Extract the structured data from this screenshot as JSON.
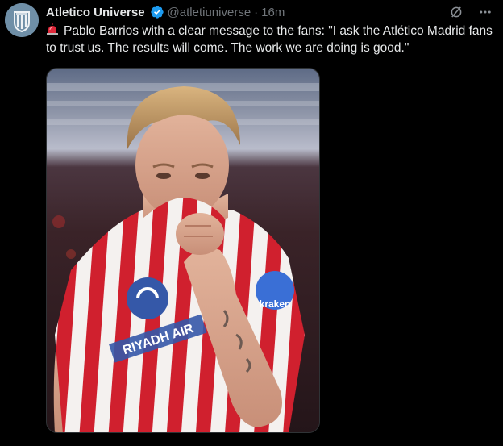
{
  "account": {
    "display_name": "Atletico Universe",
    "handle": "@atletiuniverse",
    "separator": "·",
    "time": "16m",
    "avatar_icon": "atletico-crest-icon",
    "verified": true
  },
  "post": {
    "emoji_icon": "police-siren-icon",
    "text": "Pablo Barrios with a clear message to the fans: \"I ask the Atlético Madrid fans to trust us. The results will come. The work we are doing is good.\""
  },
  "media": {
    "kind": "photo",
    "shirt_sponsor": "RIYADH AIR",
    "sleeve_badge": "kraken"
  },
  "actions": {
    "grok_icon": "grok-icon",
    "more_icon": "more-options-icon"
  },
  "colors": {
    "background": "#000000",
    "text_primary": "#e7e9ea",
    "text_secondary": "#71767b",
    "verified_blue": "#1d9bf0",
    "stripe_red": "#d0202e"
  }
}
